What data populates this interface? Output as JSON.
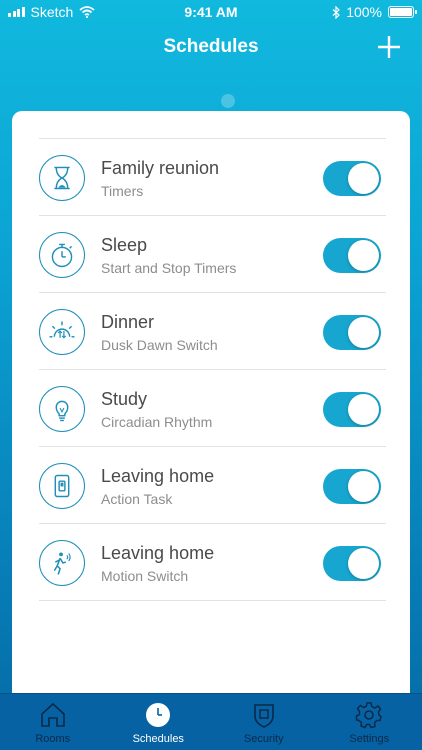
{
  "status_bar": {
    "carrier": "Sketch",
    "time": "9:41 AM",
    "battery": "100%"
  },
  "header": {
    "title": "Schedules",
    "add_icon": "plus-icon"
  },
  "schedules": [
    {
      "title": "Family reunion",
      "subtitle": "Timers",
      "icon": "hourglass-icon",
      "enabled": true
    },
    {
      "title": "Sleep",
      "subtitle": "Start and Stop Timers",
      "icon": "stopwatch-icon",
      "enabled": true
    },
    {
      "title": "Dinner",
      "subtitle": "Dusk Dawn Switch",
      "icon": "sunrise-icon",
      "enabled": true
    },
    {
      "title": "Study",
      "subtitle": "Circadian Rhythm",
      "icon": "lightbulb-icon",
      "enabled": true
    },
    {
      "title": "Leaving home",
      "subtitle": "Action Task",
      "icon": "switch-panel-icon",
      "enabled": true
    },
    {
      "title": "Leaving home",
      "subtitle": "Motion Switch",
      "icon": "motion-person-icon",
      "enabled": true
    }
  ],
  "tabs": [
    {
      "label": "Rooms",
      "icon": "house-icon",
      "active": false
    },
    {
      "label": "Schedules",
      "icon": "clock-icon",
      "active": true
    },
    {
      "label": "Security",
      "icon": "shield-icon",
      "active": false
    },
    {
      "label": "Settings",
      "icon": "gear-icon",
      "active": false
    }
  ],
  "colors": {
    "accent": "#17a6cf",
    "tab_bar": "#0762a4"
  }
}
